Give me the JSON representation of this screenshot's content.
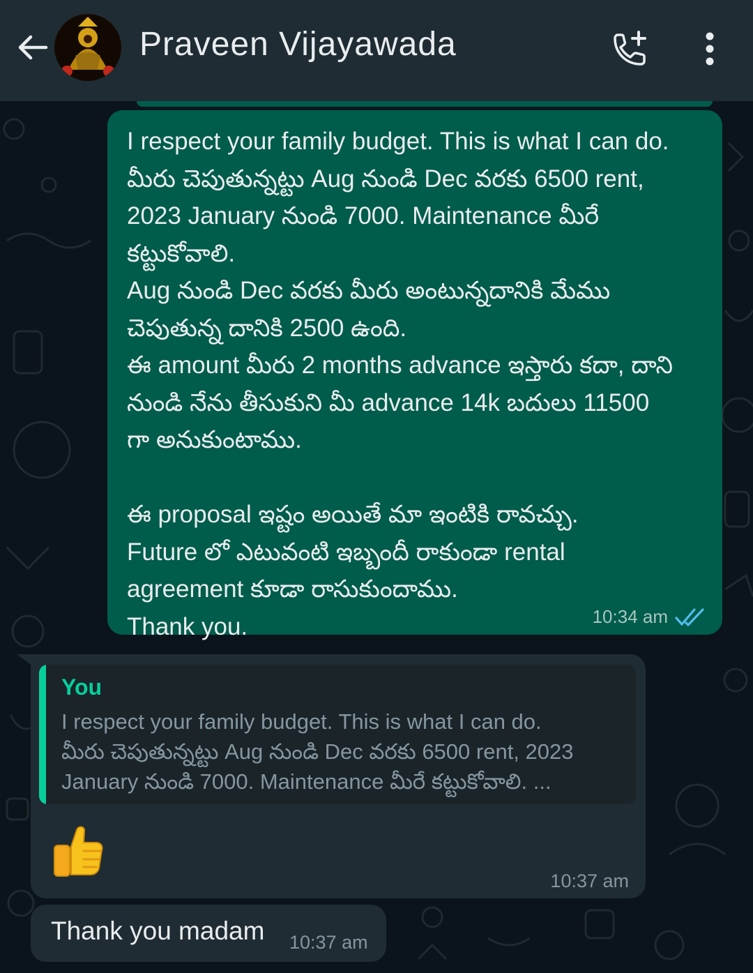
{
  "header": {
    "contact_name": "Praveen Vijayawada",
    "back_icon": "arrow-left-icon",
    "call_icon": "add-call-icon",
    "menu_icon": "more-vertical-icon"
  },
  "outgoing_message": {
    "lines": [
      "I respect your family budget. This is what I can do.",
      "మీరు చెపుతున్నట్టు Aug నుండి Dec వరకు 6500 rent,",
      "2023 January నుండి 7000. Maintenance మీరే",
      "కట్టుకోవాలి.",
      "Aug నుండి Dec వరకు మీరు అంటున్నదానికి మేము",
      "చెపుతున్న దానికి 2500 ఉంది.",
      "ఈ amount మీరు 2 months advance ఇస్తారు కదా, దాని",
      "నుండి నేను తీసుకుని మీ advance 14k బదులు 11500",
      "గా అనుకుంటాము.",
      "",
      "ఈ proposal  ఇష్టం అయితే మా ఇంటికి రావచ్చు.",
      "Future లో ఎటువంటి ఇబ్బందీ రాకుండా rental",
      "agreement కూడా రాసుకుందాము.",
      "Thank you."
    ],
    "time": "10:34 am",
    "status_icon": "double-check-read-icon"
  },
  "reply_message": {
    "quoted_author": "You",
    "quoted_lines": [
      "I respect your family budget. This is what I can do.",
      "మీరు చెపుతున్నట్టు Aug నుండి Dec వరకు 6500 rent, 2023",
      "January నుండి 7000. Maintenance మీరే కట్టుకోవాలి. ..."
    ],
    "emoji": "thumbs-up-emoji",
    "time": "10:37 am"
  },
  "last_message": {
    "text": "Thank you madam",
    "time": "10:37 am"
  },
  "colors": {
    "header_bg": "#1f2c33",
    "chat_bg": "#0b141a",
    "outgoing_bubble": "#005c4b",
    "incoming_bubble": "#202c33",
    "accent": "#06cf9c",
    "read_tick": "#53bdeb"
  }
}
